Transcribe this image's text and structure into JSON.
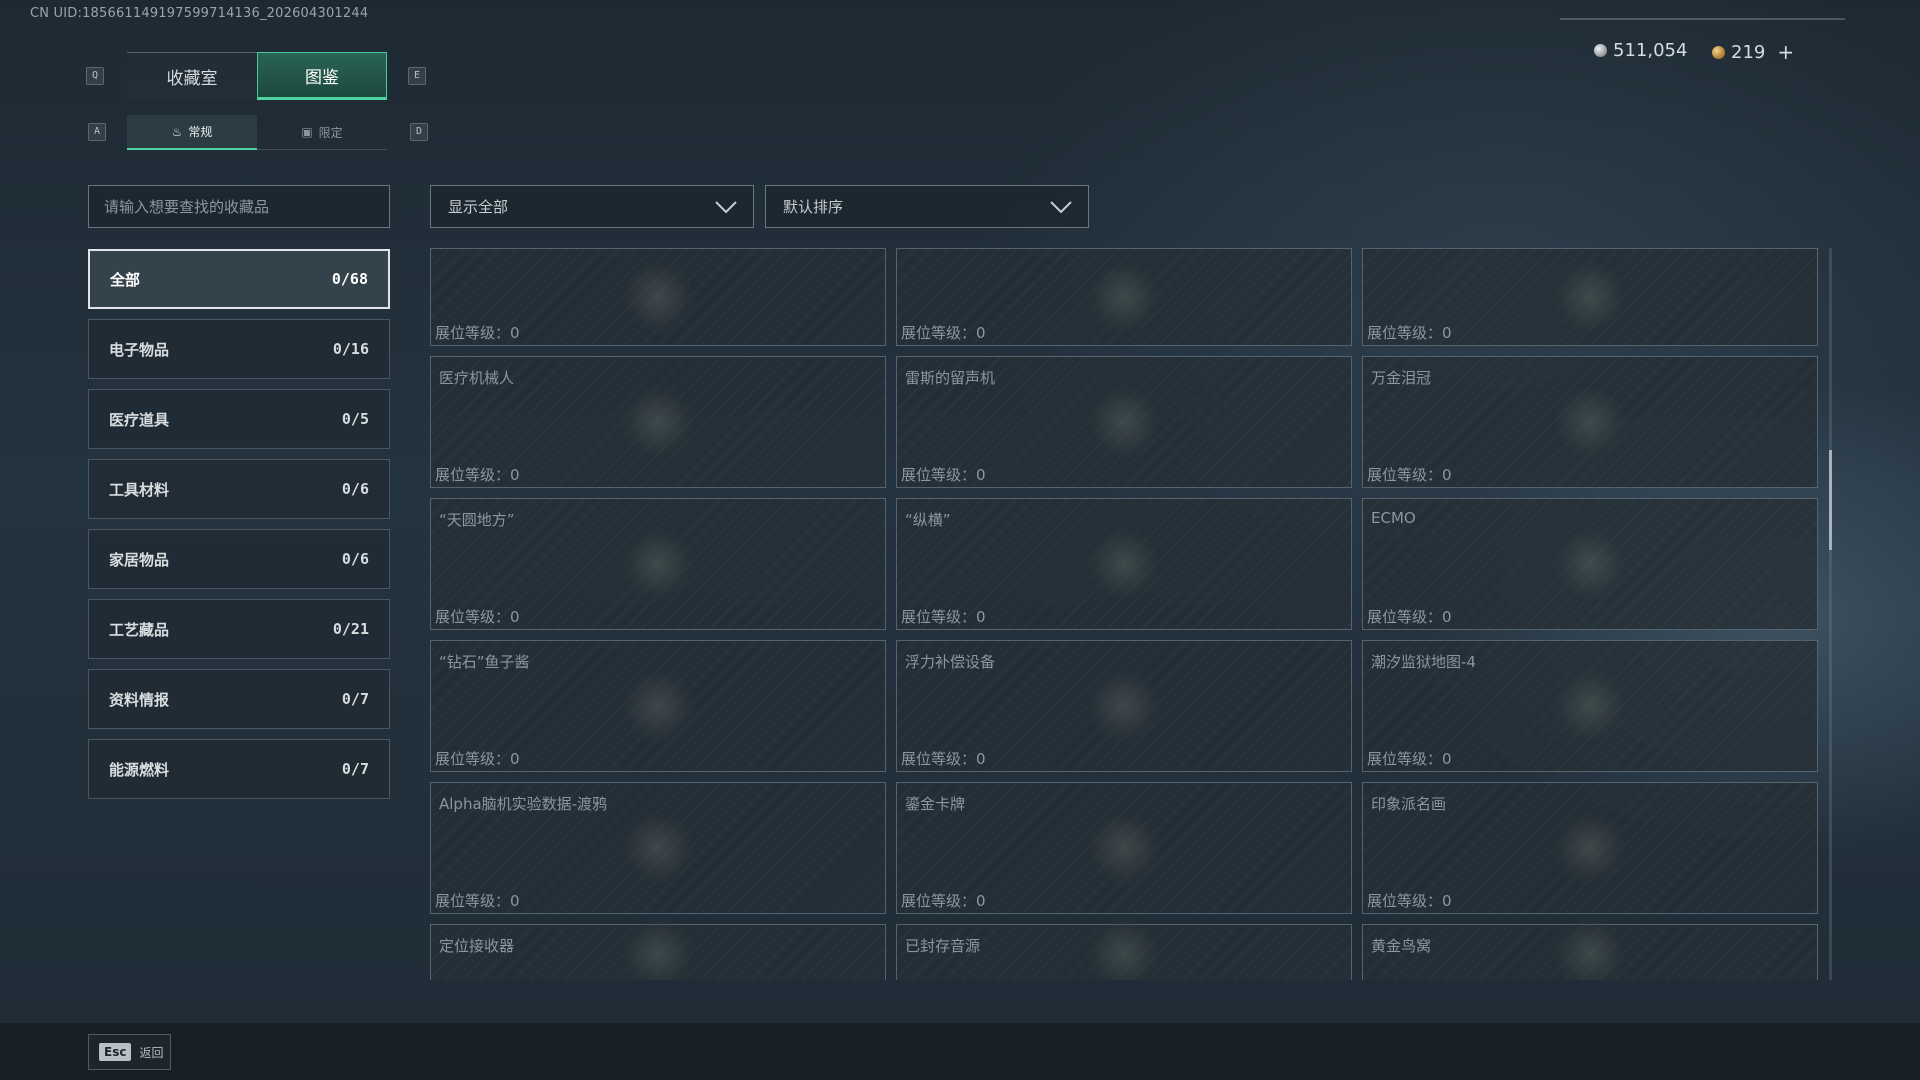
{
  "uid": "CN UID:18566114919759971413​6_202604301244",
  "header": {
    "tab_prev_key": "Q",
    "tab_next_key": "E",
    "tabs": [
      {
        "label": "收藏室"
      },
      {
        "label": "图鉴"
      }
    ],
    "subtab_prev_key": "A",
    "subtab_next_key": "D",
    "subtabs": [
      {
        "label": "常规",
        "icon": "flame-icon"
      },
      {
        "label": "限定",
        "icon": "image-icon"
      }
    ]
  },
  "currency": {
    "silver": "511,054",
    "gold": "219",
    "plus": "+"
  },
  "search": {
    "placeholder": "请输入想要查找的收藏品",
    "value": ""
  },
  "categories": [
    {
      "label": "全部",
      "count": "0/68",
      "active": true
    },
    {
      "label": "电子物品",
      "count": "0/16"
    },
    {
      "label": "医疗道具",
      "count": "0/5"
    },
    {
      "label": "工具材料",
      "count": "0/6"
    },
    {
      "label": "家居物品",
      "count": "0/6"
    },
    {
      "label": "工艺藏品",
      "count": "0/21"
    },
    {
      "label": "资料情报",
      "count": "0/7"
    },
    {
      "label": "能源燃料",
      "count": "0/7"
    }
  ],
  "filters": {
    "show": "显示全部",
    "sort": "默认排序"
  },
  "items": [
    {
      "name": "",
      "level": "展位等级：0"
    },
    {
      "name": "",
      "level": "展位等级：0"
    },
    {
      "name": "",
      "level": "展位等级：0"
    },
    {
      "name": "医疗机械人",
      "level": "展位等级：0"
    },
    {
      "name": "雷斯的留声机",
      "level": "展位等级：0"
    },
    {
      "name": "万金泪冠",
      "level": "展位等级：0"
    },
    {
      "name": "“天圆地方”",
      "level": "展位等级：0"
    },
    {
      "name": "“纵横”",
      "level": "展位等级：0"
    },
    {
      "name": "ECMO",
      "level": "展位等级：0"
    },
    {
      "name": "“钻石”鱼子酱",
      "level": "展位等级：0"
    },
    {
      "name": "浮力补偿设备",
      "level": "展位等级：0"
    },
    {
      "name": "潮汐监狱地图-4",
      "level": "展位等级：0"
    },
    {
      "name": "Alpha脑机实验数据-渡鸦",
      "level": "展位等级：0"
    },
    {
      "name": "鎏金卡牌",
      "level": "展位等级：0"
    },
    {
      "name": "印象派名画",
      "level": "展位等级：0"
    },
    {
      "name": "定位接收器",
      "level": ""
    },
    {
      "name": "已封存音源",
      "level": ""
    },
    {
      "name": "黄金鸟窝",
      "level": ""
    }
  ],
  "footer": {
    "back_key": "Esc",
    "back_label": "返回"
  }
}
